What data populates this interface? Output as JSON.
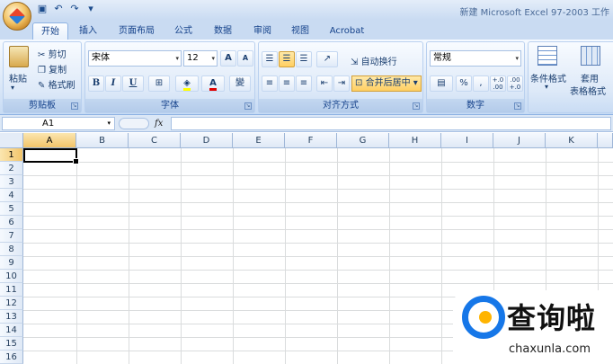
{
  "title_bar": {
    "title": "新建 Microsoft Excel 97-2003 工作",
    "qat_icons": [
      "save-icon",
      "undo-icon",
      "redo-icon",
      "customize-icon"
    ]
  },
  "tabs": [
    "开始",
    "插入",
    "页面布局",
    "公式",
    "数据",
    "审阅",
    "视图",
    "Acrobat"
  ],
  "ribbon": {
    "clipboard": {
      "label": "剪贴板",
      "paste": "粘贴",
      "cut": "剪切",
      "copy": "复制",
      "format_painter": "格式刷"
    },
    "font": {
      "label": "字体",
      "font_name": "宋体",
      "font_size": "12",
      "grow": "A",
      "shrink": "A",
      "bold": "B",
      "italic": "I",
      "underline": "U",
      "wen": "變"
    },
    "alignment": {
      "label": "对齐方式",
      "wrap_text": "自动换行",
      "merge_center": "合并后居中"
    },
    "number": {
      "label": "数字",
      "format": "常规",
      "percent": "%",
      "comma": ",",
      "inc_dec": "+.0 .00",
      "dec_dec": ".00 +.0"
    },
    "styles": {
      "conditional": "条件格式",
      "table_format_1": "套用",
      "table_format_2": "表格格式"
    }
  },
  "formula_bar": {
    "name_box": "A1",
    "fx": "fx"
  },
  "sheet": {
    "columns": [
      "A",
      "B",
      "C",
      "D",
      "E",
      "F",
      "G",
      "H",
      "I",
      "J",
      "K"
    ],
    "rows": [
      "1",
      "2",
      "3",
      "4",
      "5",
      "6",
      "7",
      "8",
      "9",
      "10",
      "11",
      "12",
      "13",
      "14",
      "15",
      "16"
    ],
    "active_cell": "A1"
  },
  "watermark": {
    "title": "查询啦",
    "site": "chaxunla.com"
  }
}
